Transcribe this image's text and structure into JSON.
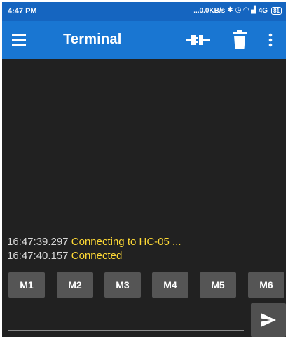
{
  "status_bar": {
    "time": "4:47 PM",
    "speed": "...0.0KB/s",
    "network": "4G",
    "battery": "81",
    "icons": [
      "bluetooth-icon",
      "alarm-icon",
      "wifi-icon",
      "signal-icon"
    ]
  },
  "app_bar": {
    "title": "Terminal",
    "icons": [
      "menu-icon",
      "connect-icon",
      "trash-icon",
      "more-icon"
    ]
  },
  "terminal": {
    "lines": [
      {
        "timestamp": "16:47:39.297",
        "message": "Connecting to HC-05 ..."
      },
      {
        "timestamp": "16:47:40.157",
        "message": "Connected"
      }
    ]
  },
  "macros": [
    "M1",
    "M2",
    "M3",
    "M4",
    "M5",
    "M6"
  ],
  "input": {
    "value": "",
    "placeholder": ""
  },
  "colors": {
    "status_bar": "#1565c0",
    "app_bar": "#1976d2",
    "background": "#212121",
    "timestamp": "#d9d9d9",
    "message": "#fdd835",
    "button": "#555555"
  }
}
